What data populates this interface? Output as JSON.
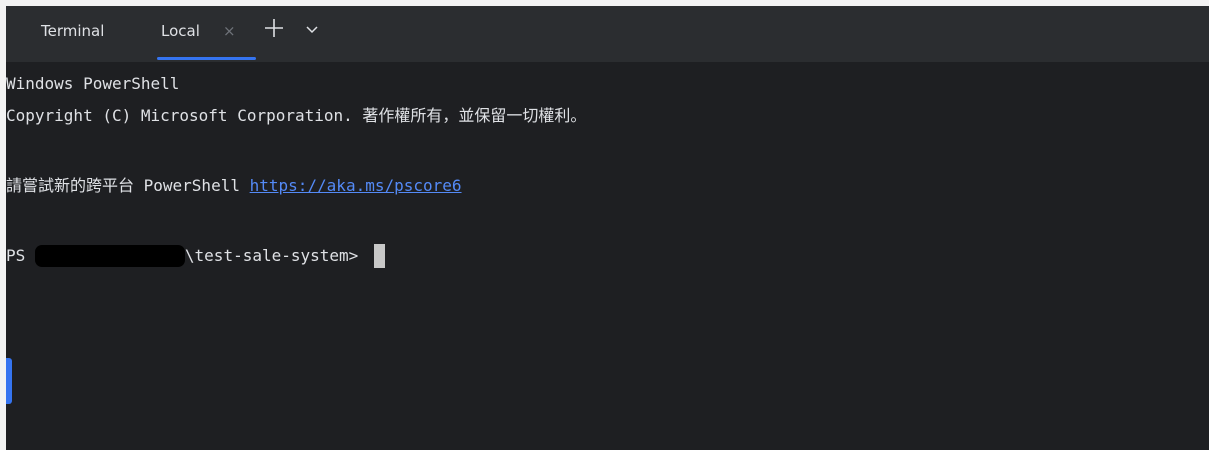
{
  "tabbar": {
    "title": "Terminal",
    "tabs": [
      {
        "label": "Local",
        "active": true
      }
    ],
    "close_glyph": "×",
    "icons": {
      "close": "close-icon",
      "add": "plus-icon",
      "dropdown": "chevron-down-icon"
    }
  },
  "terminal": {
    "line1": "Windows PowerShell",
    "line2": "Copyright (C) Microsoft Corporation. 著作權所有，並保留一切權利。",
    "line4_text": "請嘗試新的跨平台 PowerShell ",
    "line4_link": "https://aka.ms/pscore6",
    "prompt_prefix": "PS ",
    "prompt_path_suffix": "\\test-sale-system> "
  },
  "colors": {
    "background": "#1e1f22",
    "tabbar": "#2b2d30",
    "text": "#dfe1e5",
    "link": "#548af7",
    "accent": "#3574f0",
    "cursor": "#c8c8c8"
  }
}
